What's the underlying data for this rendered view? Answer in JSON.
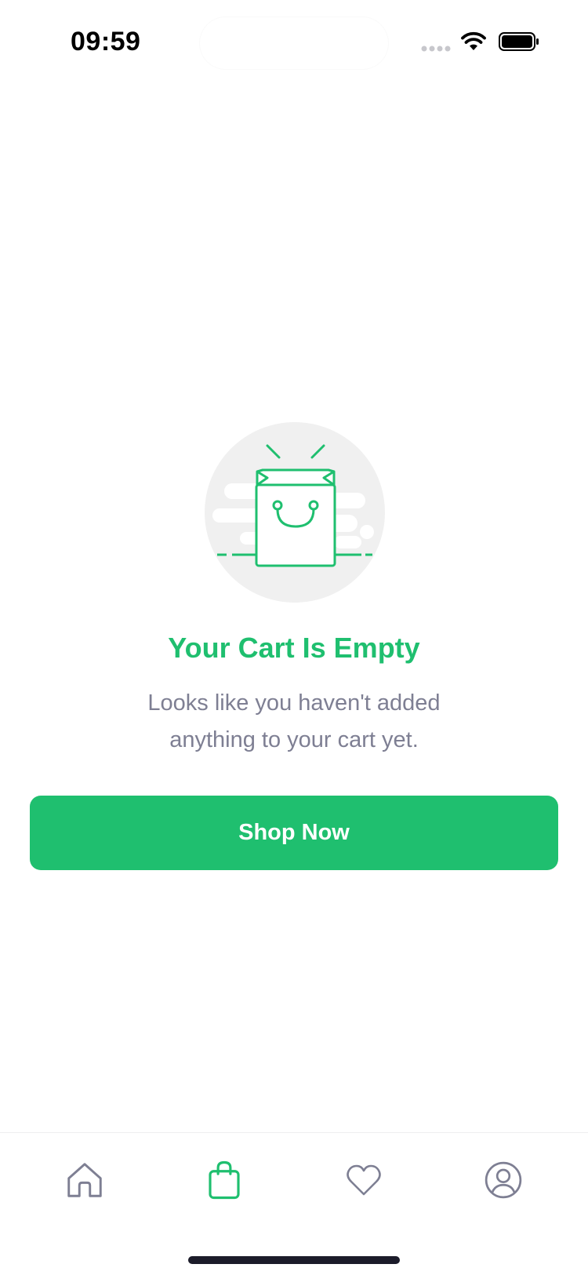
{
  "status_bar": {
    "time": "09:59"
  },
  "empty_state": {
    "title": "Your Cart Is Empty",
    "subtitle": "Looks like you haven't added anything to your cart yet.",
    "illustration": "shopping-bag-illustration"
  },
  "cta": {
    "label": "Shop Now"
  },
  "tab_bar": {
    "items": [
      {
        "icon": "home-icon",
        "active": false
      },
      {
        "icon": "shopping-bag-icon",
        "active": true
      },
      {
        "icon": "heart-icon",
        "active": false
      },
      {
        "icon": "user-icon",
        "active": false
      }
    ]
  },
  "colors": {
    "accent": "#1fbf6f",
    "muted_text": "#7e7f93",
    "inactive_icon": "#7e7f93",
    "illustration_bg": "#f0f0f0"
  }
}
